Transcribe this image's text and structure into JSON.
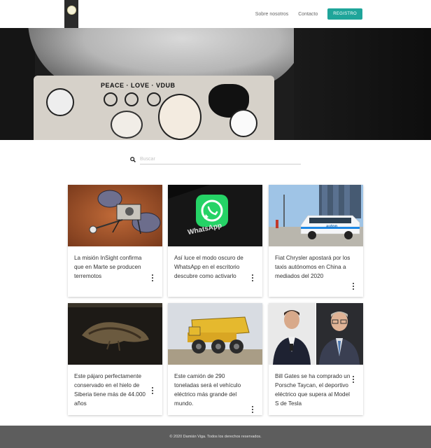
{
  "header": {
    "logo_name": "site-logo",
    "nav": [
      {
        "label": "Sobre nosotros"
      },
      {
        "label": "Contacto"
      }
    ],
    "register_label": "REGISTRO",
    "accent": "#1fa59a"
  },
  "hero": {
    "laptop_text": "PEACE · LOVE · VDUB"
  },
  "search": {
    "placeholder": "Buscar",
    "value": ""
  },
  "cards": [
    {
      "title": "La misión InSight confirma que en Marte se producen terremotos"
    },
    {
      "title": "Así luce el modo oscuro de WhatsApp en el escritorio descubre como activarlo"
    },
    {
      "title": "Fiat Chrysler apostará por los taxis autónomos en China a mediados del 2020"
    },
    {
      "title": "Este pájaro perfectamente conservado en el hielo de Siberia tiene más de 44.000 años"
    },
    {
      "title": "Este camión de 290 toneladas será el vehículo eléctrico más grande del mundo."
    },
    {
      "title": "Bill Gates se ha comprado un Porsche Taycan, el deportivo eléctrico que supera al Model S de Tesla"
    }
  ],
  "images": {
    "whatsapp_label": "WhatsApp",
    "van_brand": "auton"
  },
  "footer": {
    "text": "© 2020 Damián Viga. Todos los derechos reservados."
  }
}
